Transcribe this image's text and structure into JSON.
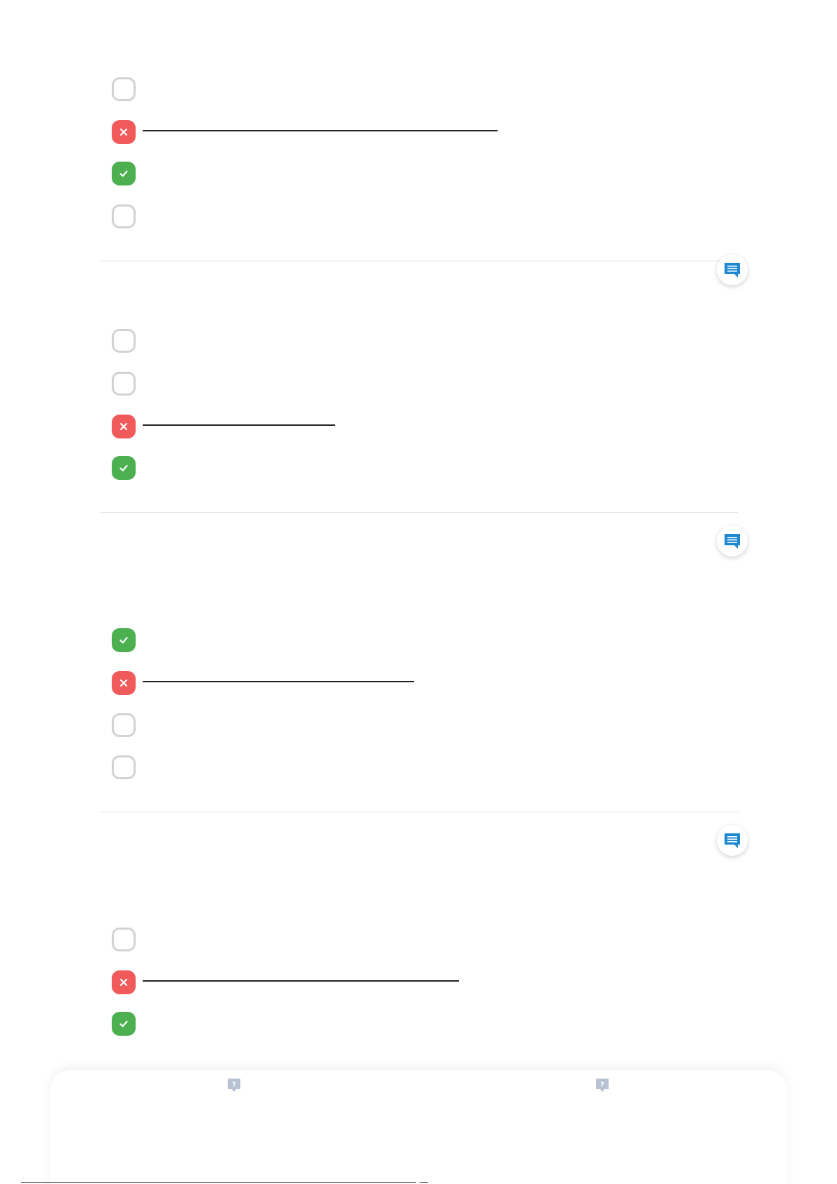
{
  "colors": {
    "wrong": "#f05a5a",
    "right": "#4caf50",
    "empty_border": "#d3d3d3",
    "comment_icon": "#1e88d0",
    "help_icon": "#b7c3d3",
    "divider": "#e2e2e2"
  },
  "questions": [
    {
      "options": [
        {
          "state": "empty",
          "icon": "empty-circle-icon",
          "struck": false
        },
        {
          "state": "wrong",
          "icon": "x-icon",
          "struck": true
        },
        {
          "state": "right",
          "icon": "check-icon",
          "struck": false
        },
        {
          "state": "empty",
          "icon": "empty-circle-icon",
          "struck": false
        }
      ]
    },
    {
      "options": [
        {
          "state": "empty",
          "icon": "empty-circle-icon",
          "struck": false
        },
        {
          "state": "empty",
          "icon": "empty-circle-icon",
          "struck": false
        },
        {
          "state": "wrong",
          "icon": "x-icon",
          "struck": true
        },
        {
          "state": "right",
          "icon": "check-icon",
          "struck": false
        }
      ]
    },
    {
      "options": [
        {
          "state": "right",
          "icon": "check-icon",
          "struck": false
        },
        {
          "state": "wrong",
          "icon": "x-icon",
          "struck": true
        },
        {
          "state": "empty",
          "icon": "empty-circle-icon",
          "struck": false
        },
        {
          "state": "empty",
          "icon": "empty-circle-icon",
          "struck": false
        }
      ]
    },
    {
      "options": [
        {
          "state": "empty",
          "icon": "empty-circle-icon",
          "struck": false
        },
        {
          "state": "wrong",
          "icon": "x-icon",
          "struck": true
        },
        {
          "state": "right",
          "icon": "check-icon",
          "struck": false
        }
      ]
    }
  ],
  "comment_buttons": [
    {
      "icon": "comment-icon"
    },
    {
      "icon": "comment-icon"
    },
    {
      "icon": "comment-icon"
    }
  ],
  "bottom_panel": {
    "help_icons": [
      {
        "icon": "help-bubble-icon",
        "glyph": "?"
      },
      {
        "icon": "help-bubble-icon",
        "glyph": "?"
      }
    ]
  }
}
